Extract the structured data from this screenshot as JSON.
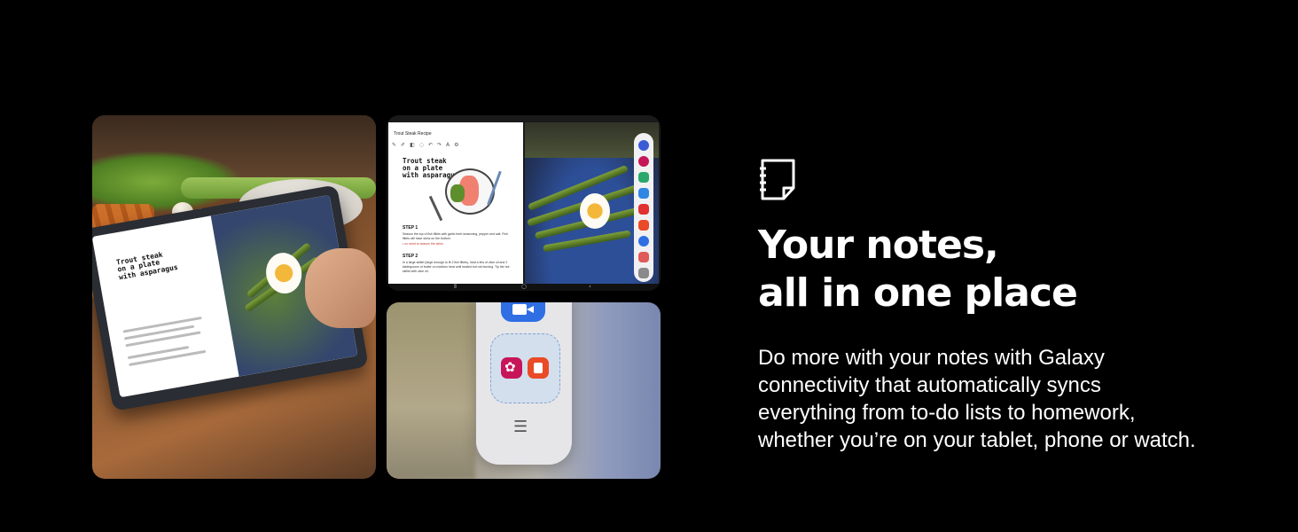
{
  "headline": {
    "line1": "Your notes,",
    "line2": "all in one place"
  },
  "body": {
    "line1": "Do more with your notes with Galaxy",
    "line2": "connectivity that automatically syncs",
    "line3": "everything from to-do lists to homework,",
    "line4": "whether you’re on your tablet, phone or watch."
  },
  "icon": "notes-icon",
  "tablet_note": {
    "app_title": "Trout Steak Recipe",
    "note_heading": [
      "Trout steak",
      "on a plate",
      "with asparagus"
    ],
    "step1_label": "STEP 1",
    "step1_text": "Season the top of fish fillets with garlic herb seasoning, pepper and salt. Fish fillets will have skins on the bottom.",
    "step1_note": "• no need to season the skins.",
    "step2_label": "STEP 2",
    "step2_text": "In a large skillet (large enough to fit 2 fish fillets), heat a few of olive oil and 2 tablespoons of butter on medium heat until heated but not burning. Tip the hot skillet with olive oil."
  },
  "colors": {
    "background": "#000000",
    "text": "#ffffff",
    "video_app": "#2f6fe3",
    "flower_app": "#c7155a",
    "notes_app": "#ea4a26"
  }
}
